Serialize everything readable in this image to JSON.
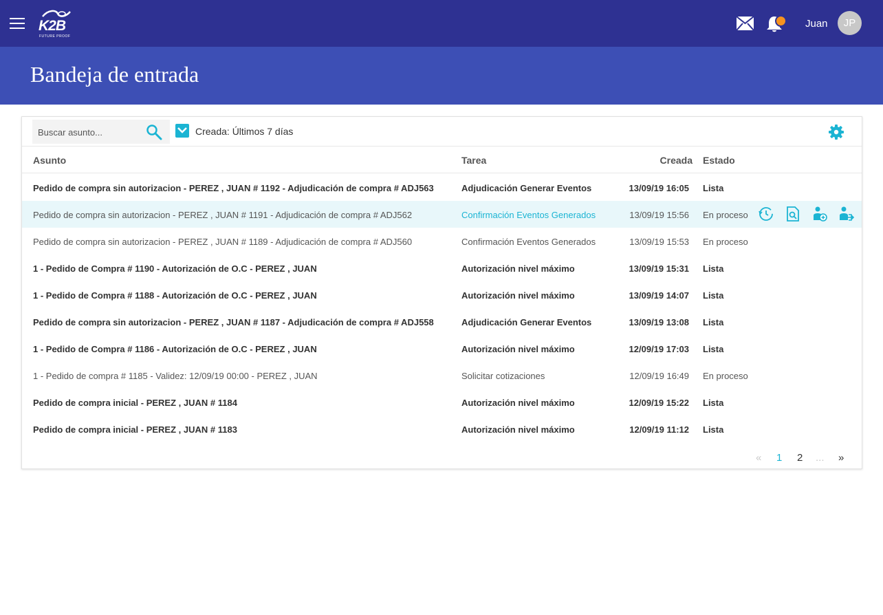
{
  "header": {
    "logo_text": "K2B",
    "logo_tagline": "FUTURE PROOF",
    "user_name": "Juan",
    "avatar_initials": "JP",
    "notification_color": "#f7931e"
  },
  "page": {
    "title": "Bandeja de entrada"
  },
  "toolbar": {
    "search_placeholder": "Buscar asunto...",
    "filter_label": "Creada: Últimos 7 días",
    "accent_color": "#1bb4d3"
  },
  "table": {
    "columns": {
      "asunto": "Asunto",
      "tarea": "Tarea",
      "creada": "Creada",
      "estado": "Estado"
    },
    "rows": [
      {
        "asunto": "Pedido de compra sin autorizacion - PEREZ , JUAN # 1192 - Adjudicación de compra # ADJ563",
        "tarea": "Adjudicación Generar Eventos",
        "creada": "13/09/19 16:05",
        "estado": "Lista",
        "bold": true
      },
      {
        "asunto": "Pedido de compra sin autorizacion - PEREZ , JUAN # 1191 - Adjudicación de compra # ADJ562",
        "tarea": "Confirmación Eventos Generados",
        "creada": "13/09/19 15:56",
        "estado": "En proceso",
        "bold": false
      },
      {
        "asunto": "Pedido de compra sin autorizacion - PEREZ , JUAN # 1189 - Adjudicación de compra # ADJ560",
        "tarea": "Confirmación Eventos Generados",
        "creada": "13/09/19 15:53",
        "estado": "En proceso",
        "bold": false
      },
      {
        "asunto": "1 - Pedido de Compra # 1190 - Autorización de O.C - PEREZ , JUAN",
        "tarea": "Autorización nivel máximo",
        "creada": "13/09/19 15:31",
        "estado": "Lista",
        "bold": true
      },
      {
        "asunto": "1 - Pedido de Compra # 1188 - Autorización de O.C - PEREZ , JUAN",
        "tarea": "Autorización nivel máximo",
        "creada": "13/09/19 14:07",
        "estado": "Lista",
        "bold": true
      },
      {
        "asunto": "Pedido de compra sin autorizacion - PEREZ , JUAN # 1187 - Adjudicación de compra # ADJ558",
        "tarea": "Adjudicación Generar Eventos",
        "creada": "13/09/19 13:08",
        "estado": "Lista",
        "bold": true
      },
      {
        "asunto": "1 - Pedido de Compra # 1186 - Autorización de O.C - PEREZ , JUAN",
        "tarea": "Autorización nivel máximo",
        "creada": "12/09/19 17:03",
        "estado": "Lista",
        "bold": true
      },
      {
        "asunto": "1 - Pedido de compra # 1185 - Validez: 12/09/19 00:00 - PEREZ , JUAN",
        "tarea": "Solicitar cotizaciones",
        "creada": "12/09/19 16:49",
        "estado": "En proceso",
        "bold": false
      },
      {
        "asunto": "Pedido de compra inicial - PEREZ , JUAN # 1184",
        "tarea": "Autorización nivel máximo",
        "creada": "12/09/19 15:22",
        "estado": "Lista",
        "bold": true
      },
      {
        "asunto": "Pedido de compra inicial - PEREZ , JUAN # 1183",
        "tarea": "Autorización nivel máximo",
        "creada": "12/09/19 11:12",
        "estado": "Lista",
        "bold": true
      }
    ],
    "hovered_row": 1,
    "row_actions": [
      "history-icon",
      "document-search-icon",
      "user-add-icon",
      "user-reassign-icon"
    ]
  },
  "pagination": {
    "prev": "«",
    "pages": [
      "1",
      "2"
    ],
    "ellipsis": "...",
    "next": "»",
    "current": "1"
  }
}
